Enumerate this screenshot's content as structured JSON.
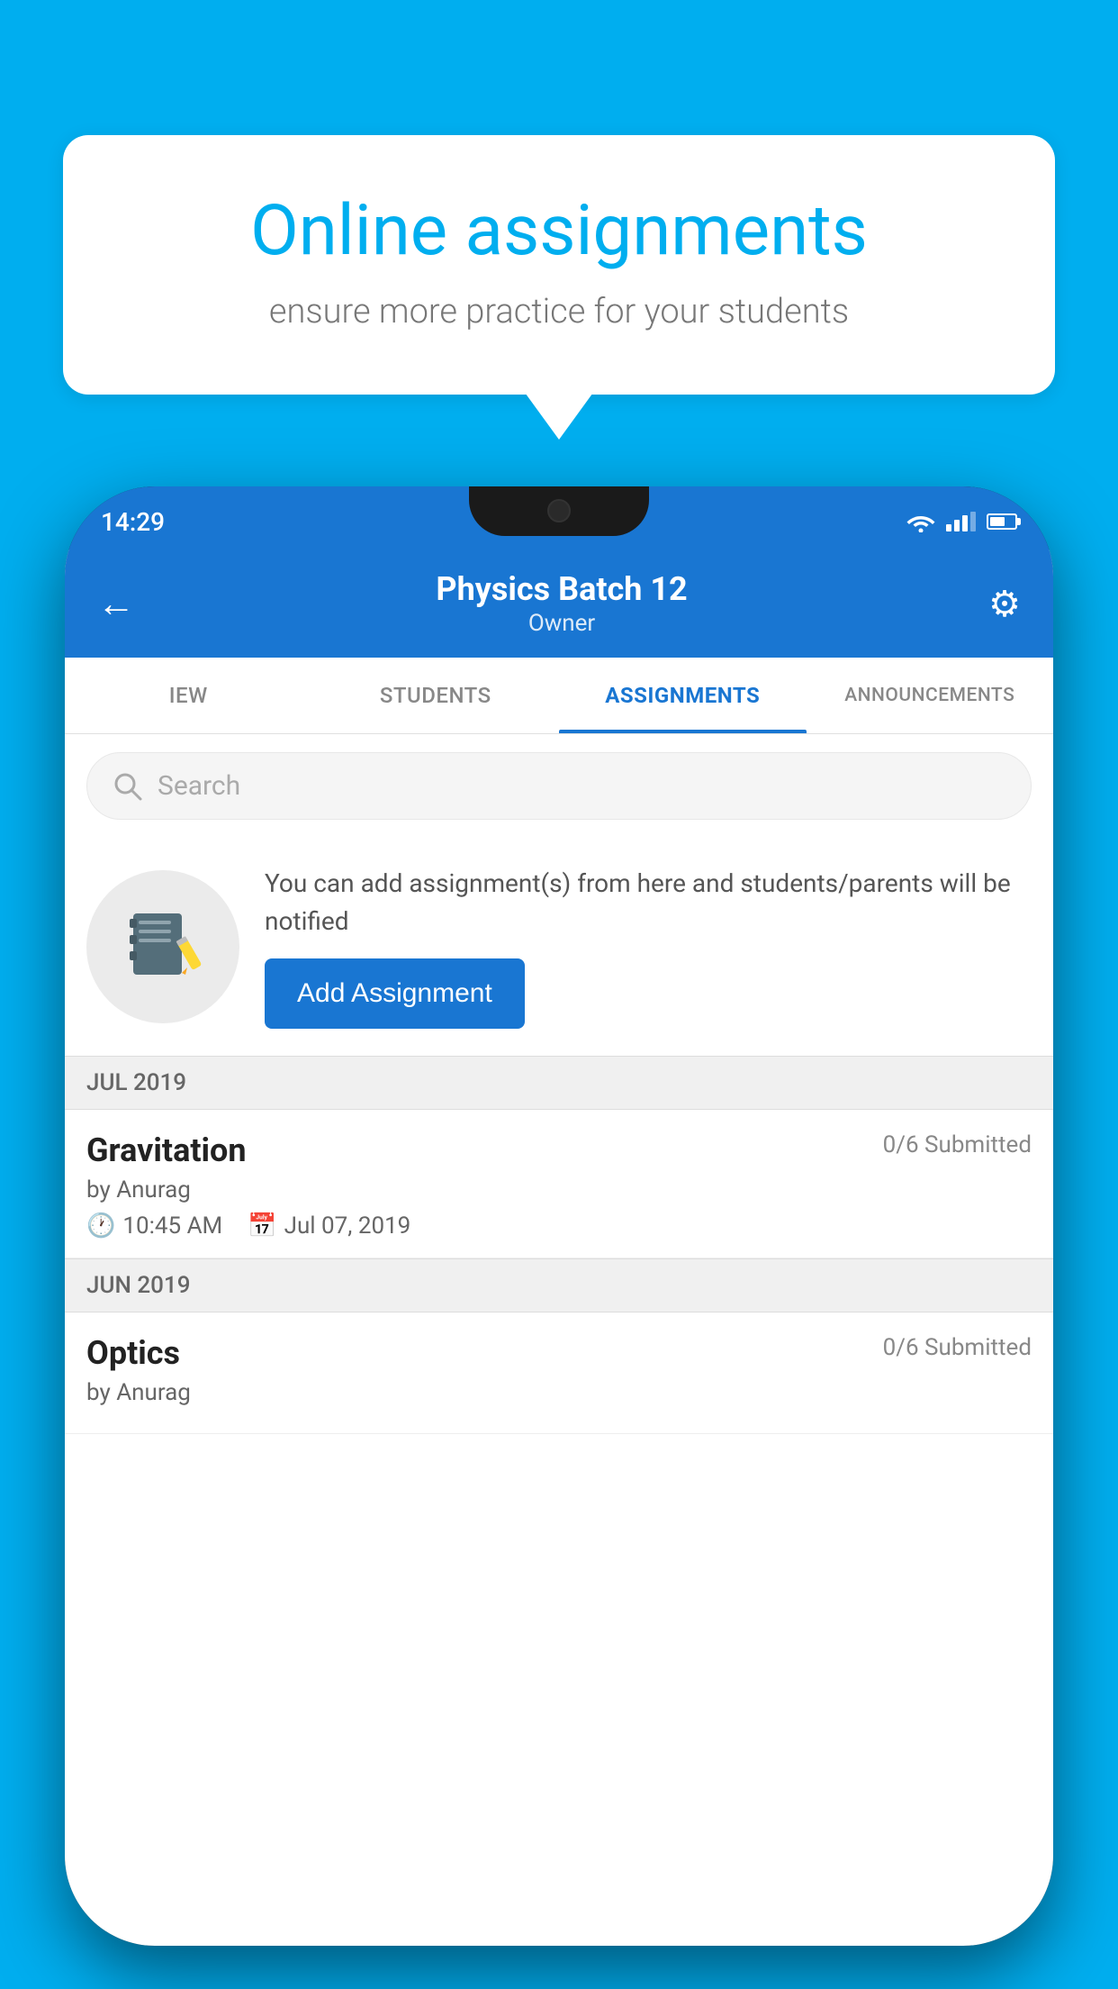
{
  "background_color": "#00AEEF",
  "speech_bubble": {
    "title": "Online assignments",
    "subtitle": "ensure more practice for your students"
  },
  "status_bar": {
    "time": "14:29"
  },
  "header": {
    "title": "Physics Batch 12",
    "subtitle": "Owner",
    "back_label": "←",
    "settings_label": "⚙"
  },
  "tabs": [
    {
      "id": "iew",
      "label": "IEW",
      "active": false
    },
    {
      "id": "students",
      "label": "STUDENTS",
      "active": false
    },
    {
      "id": "assignments",
      "label": "ASSIGNMENTS",
      "active": true
    },
    {
      "id": "announcements",
      "label": "ANNOUNCEMENTS",
      "active": false
    }
  ],
  "search": {
    "placeholder": "Search"
  },
  "info_banner": {
    "description": "You can add assignment(s) from here and students/parents will be notified",
    "button_label": "Add Assignment"
  },
  "sections": [
    {
      "header": "JUL 2019",
      "assignments": [
        {
          "name": "Gravitation",
          "submitted": "0/6 Submitted",
          "author": "by Anurag",
          "time": "10:45 AM",
          "date": "Jul 07, 2019"
        }
      ]
    },
    {
      "header": "JUN 2019",
      "assignments": [
        {
          "name": "Optics",
          "submitted": "0/6 Submitted",
          "author": "by Anurag",
          "time": "",
          "date": ""
        }
      ]
    }
  ]
}
